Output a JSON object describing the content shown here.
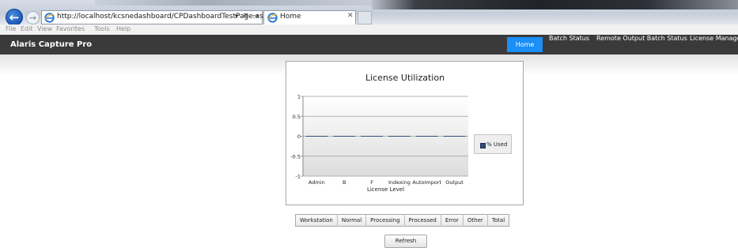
{
  "browser": {
    "address": "http://localhost/kcsnedashboard/CPDashboardTestPage.aspx#/Home",
    "tab_title": "Home",
    "menu": [
      "File",
      "Edit",
      "View",
      "Favorites",
      "Tools",
      "Help"
    ]
  },
  "navbar": {
    "brand": "Alaris Capture Pro",
    "links": [
      "Home",
      "Batch Status",
      "Remote Output Batch Status",
      "License Manager"
    ],
    "active": "Home",
    "active_color": "#1a8ff7"
  },
  "chart_data": {
    "type": "bar",
    "title": "License Utilization",
    "xlabel": "License Level",
    "ylabel": "",
    "categories": [
      "Admin",
      "B",
      "F",
      "Indexing",
      "AutoImport",
      "Output"
    ],
    "series": [
      {
        "name": "% Used",
        "values": [
          0,
          0,
          0,
          0,
          0,
          0
        ]
      }
    ],
    "ylim": [
      -1,
      1
    ],
    "yticks": [
      "1",
      "0.5",
      "0",
      "-0.5",
      "-1"
    ],
    "grid": true,
    "legend": "right"
  },
  "status_table": {
    "headers": [
      "Workstation",
      "Normal",
      "Processing",
      "Processed",
      "Error",
      "Other",
      "Total"
    ]
  },
  "refresh_label": "Refresh"
}
